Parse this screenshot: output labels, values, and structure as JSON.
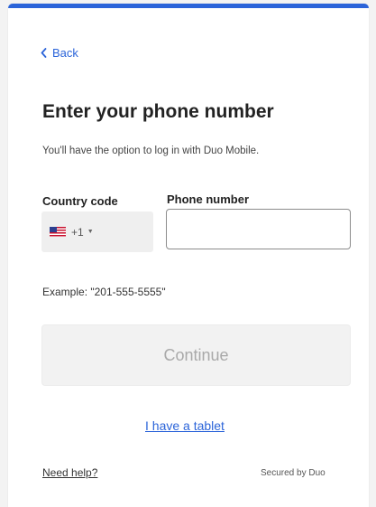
{
  "header": {
    "back_label": "Back",
    "accent_color": "#2b64d9"
  },
  "main": {
    "title": "Enter your phone number",
    "subtitle": "You'll have the option to log in with Duo Mobile.",
    "country_code_label": "Country code",
    "phone_number_label": "Phone number",
    "country_select": {
      "flag_icon": "us-flag-icon",
      "selected_value": "+1",
      "caret_glyph": "▼"
    },
    "phone_input": {
      "value": "",
      "placeholder": ""
    },
    "example_text": "Example: \"201-555-5555\"",
    "continue_label": "Continue",
    "tablet_link": "I have a tablet"
  },
  "footer": {
    "help_link": "Need help?",
    "secured_text": "Secured by Duo"
  }
}
